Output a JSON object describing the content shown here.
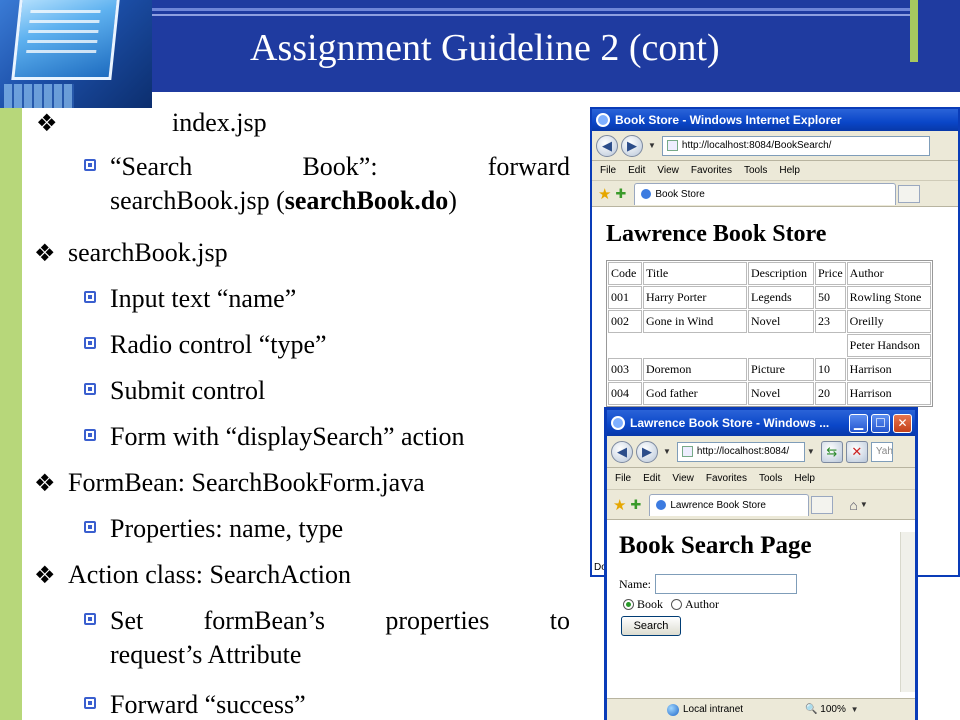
{
  "slide": {
    "title": "Assignment Guideline 2 (cont)"
  },
  "bullets": {
    "index_jsp": "index.jsp",
    "search_book_line1_a": "“Search",
    "search_book_line1_b": "Book”:",
    "search_book_line1_c": "forward",
    "search_book_line2_a": "searchBook.jsp (",
    "search_book_line2_bold": "searchBook.do",
    "search_book_line2_c": ")",
    "searchbook_jsp": "searchBook.jsp",
    "input_text": "Input text “name”",
    "radio_control": "Radio control “type”",
    "submit_control": "Submit control",
    "form_with": "Form with “displaySearch” action",
    "formbean": "FormBean: SearchBookForm.java",
    "properties": "Properties: name, type",
    "action_class": "Action class: SearchAction",
    "set_formbean_a": "Set",
    "set_formbean_b": "formBean’s",
    "set_formbean_c": "properties",
    "set_formbean_d": "to",
    "set_formbean_line2": "request’s Attribute",
    "forward_success": "Forward “success”"
  },
  "browser1": {
    "title": "Book Store - Windows Internet Explorer",
    "address": "http://localhost:8084/BookSearch/",
    "menu": [
      "File",
      "Edit",
      "View",
      "Favorites",
      "Tools",
      "Help"
    ],
    "tab": "Book Store",
    "heading": "Lawrence Book Store",
    "table": {
      "headers": [
        "Code",
        "Title",
        "Description",
        "Price",
        "Author"
      ],
      "rows": [
        [
          "001",
          "Harry Porter",
          "Legends",
          "50",
          "Rowling Stone"
        ],
        [
          "002",
          "Gone in Wind",
          "Novel",
          "23",
          "Oreilly"
        ],
        [
          "",
          "",
          "",
          "",
          "Peter Handson"
        ],
        [
          "003",
          "Doremon",
          "Picture",
          "10",
          "Harrison"
        ],
        [
          "004",
          "God father",
          "Novel",
          "20",
          "Harrison"
        ]
      ]
    },
    "status_fragment": "Do"
  },
  "browser2": {
    "title": "Lawrence Book Store - Windows ...",
    "address": "http://localhost:8084/",
    "search_fragment": "Yah",
    "menu": [
      "File",
      "Edit",
      "View",
      "Favorites",
      "Tools",
      "Help"
    ],
    "tab": "Lawrence Book Store",
    "heading": "Book Search Page",
    "name_label": "Name:",
    "radio_book": "Book",
    "radio_author": "Author",
    "search_button": "Search",
    "status_zone": "Local intranet",
    "zoom": "100%"
  }
}
